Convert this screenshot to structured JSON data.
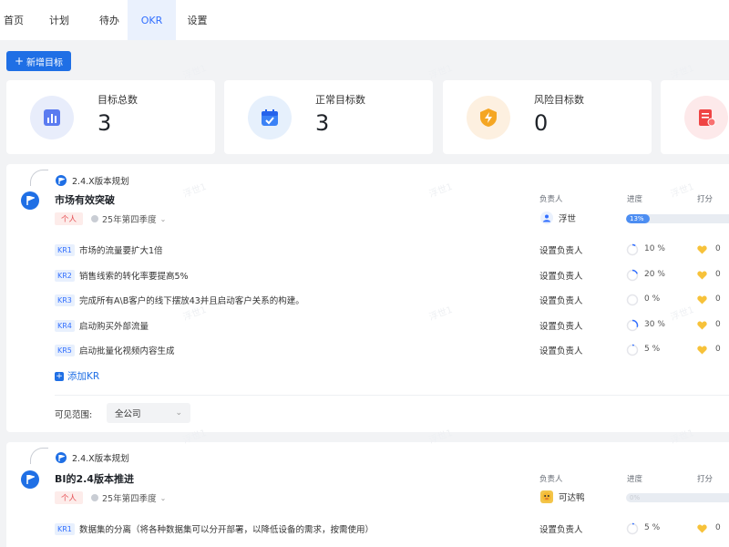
{
  "tabs": [
    {
      "label": "首页",
      "active": false
    },
    {
      "label": "计划",
      "active": false
    },
    {
      "label": "待办",
      "active": false
    },
    {
      "label": "OKR",
      "active": true
    },
    {
      "label": "设置",
      "active": false
    }
  ],
  "new_button": {
    "label": "新增目标",
    "icon": "plus-icon"
  },
  "stats": [
    {
      "label": "目标总数",
      "value": "3",
      "icon": "bar-chart-icon",
      "color": "#e8edfb"
    },
    {
      "label": "正常目标数",
      "value": "3",
      "icon": "calendar-check-icon",
      "color": "#e6f0fc"
    },
    {
      "label": "风险目标数",
      "value": "0",
      "icon": "lightning-shield-icon",
      "color": "#fdf0e0"
    },
    {
      "label": "",
      "value": "",
      "icon": "document-alert-icon",
      "color": "#fde9ea"
    }
  ],
  "columns": {
    "owner": "负责人",
    "progress": "进度",
    "score": "打分"
  },
  "objectives": [
    {
      "version": "2.4.X版本规划",
      "title": "市场有效突破",
      "tag": "个人",
      "quarter": "25年第四季度",
      "owner": "浮世",
      "owner_avatar": "person-avatar-icon",
      "progress_text": "13%",
      "progress": 13,
      "krs": [
        {
          "badge": "KR1",
          "text": "市场的流量要扩大1倍",
          "owner": "设置负责人",
          "pct": "10 %",
          "progress": 10,
          "score": "0"
        },
        {
          "badge": "KR2",
          "text": "销售线索的转化率要提高5%",
          "owner": "设置负责人",
          "pct": "20 %",
          "progress": 20,
          "score": "0"
        },
        {
          "badge": "KR3",
          "text": "完成所有A\\B客户的线下摆放43并且启动客户关系的构建。",
          "owner": "设置负责人",
          "pct": "0 %",
          "progress": 0,
          "score": "0"
        },
        {
          "badge": "KR4",
          "text": "启动购买外部流量",
          "owner": "设置负责人",
          "pct": "30 %",
          "progress": 30,
          "score": "0"
        },
        {
          "badge": "KR5",
          "text": "启动批量化视频内容生成",
          "owner": "设置负责人",
          "pct": "5 %",
          "progress": 5,
          "score": "0"
        }
      ],
      "add_kr": "添加KR",
      "visible_label": "可见范围:",
      "visible_value": "全公司"
    },
    {
      "version": "2.4.X版本规划",
      "title": "BI的2.4版本推进",
      "tag": "个人",
      "quarter": "25年第四季度",
      "owner": "可达鸭",
      "owner_avatar": "duck-avatar-icon",
      "progress_text": "0%",
      "progress": 0,
      "krs": [
        {
          "badge": "KR1",
          "text": "数据集的分离（将各种数据集可以分开部署，以降低设备的需求，按需使用）",
          "owner": "设置负责人",
          "pct": "5 %",
          "progress": 5,
          "score": "0"
        }
      ]
    }
  ],
  "watermark": "浮世1",
  "colors": {
    "primary": "#1f6fe5",
    "tag_bg": "#fdecea",
    "tag_fg": "#e5484d",
    "heart": "#f7c23a"
  }
}
